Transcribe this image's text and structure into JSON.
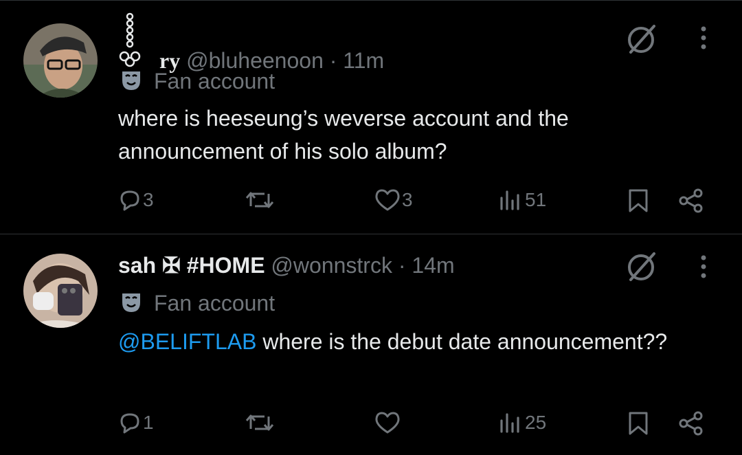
{
  "posts": [
    {
      "display_name": "ry",
      "handle": "@bluheenoon",
      "separator": "·",
      "time": "11m",
      "badge": "Fan account",
      "text_mention": "",
      "text": "where is heeseung’s weverse account and the announcement of his solo album?",
      "replies": "3",
      "reposts": "",
      "likes": "3",
      "views": "51"
    },
    {
      "display_name": "sah ✠ #HOME",
      "handle": "@wonnstrck",
      "separator": "·",
      "time": "14m",
      "badge": "Fan account",
      "text_mention": "@BELIFTLAB",
      "text": " where is the debut date announcement??",
      "replies": "1",
      "reposts": "",
      "likes": "",
      "views": "25"
    }
  ],
  "icons": {
    "reply": "reply-icon",
    "repost": "repost-icon",
    "like": "heart-icon",
    "views": "views-icon",
    "bookmark": "bookmark-icon",
    "share": "share-icon",
    "grok": "grok-icon",
    "more": "more-icon",
    "badge": "mask-icon"
  },
  "colors": {
    "background": "#000000",
    "text": "#e7e9ea",
    "muted": "#71767b",
    "mention": "#1d9bf0",
    "divider": "#2f3336"
  }
}
